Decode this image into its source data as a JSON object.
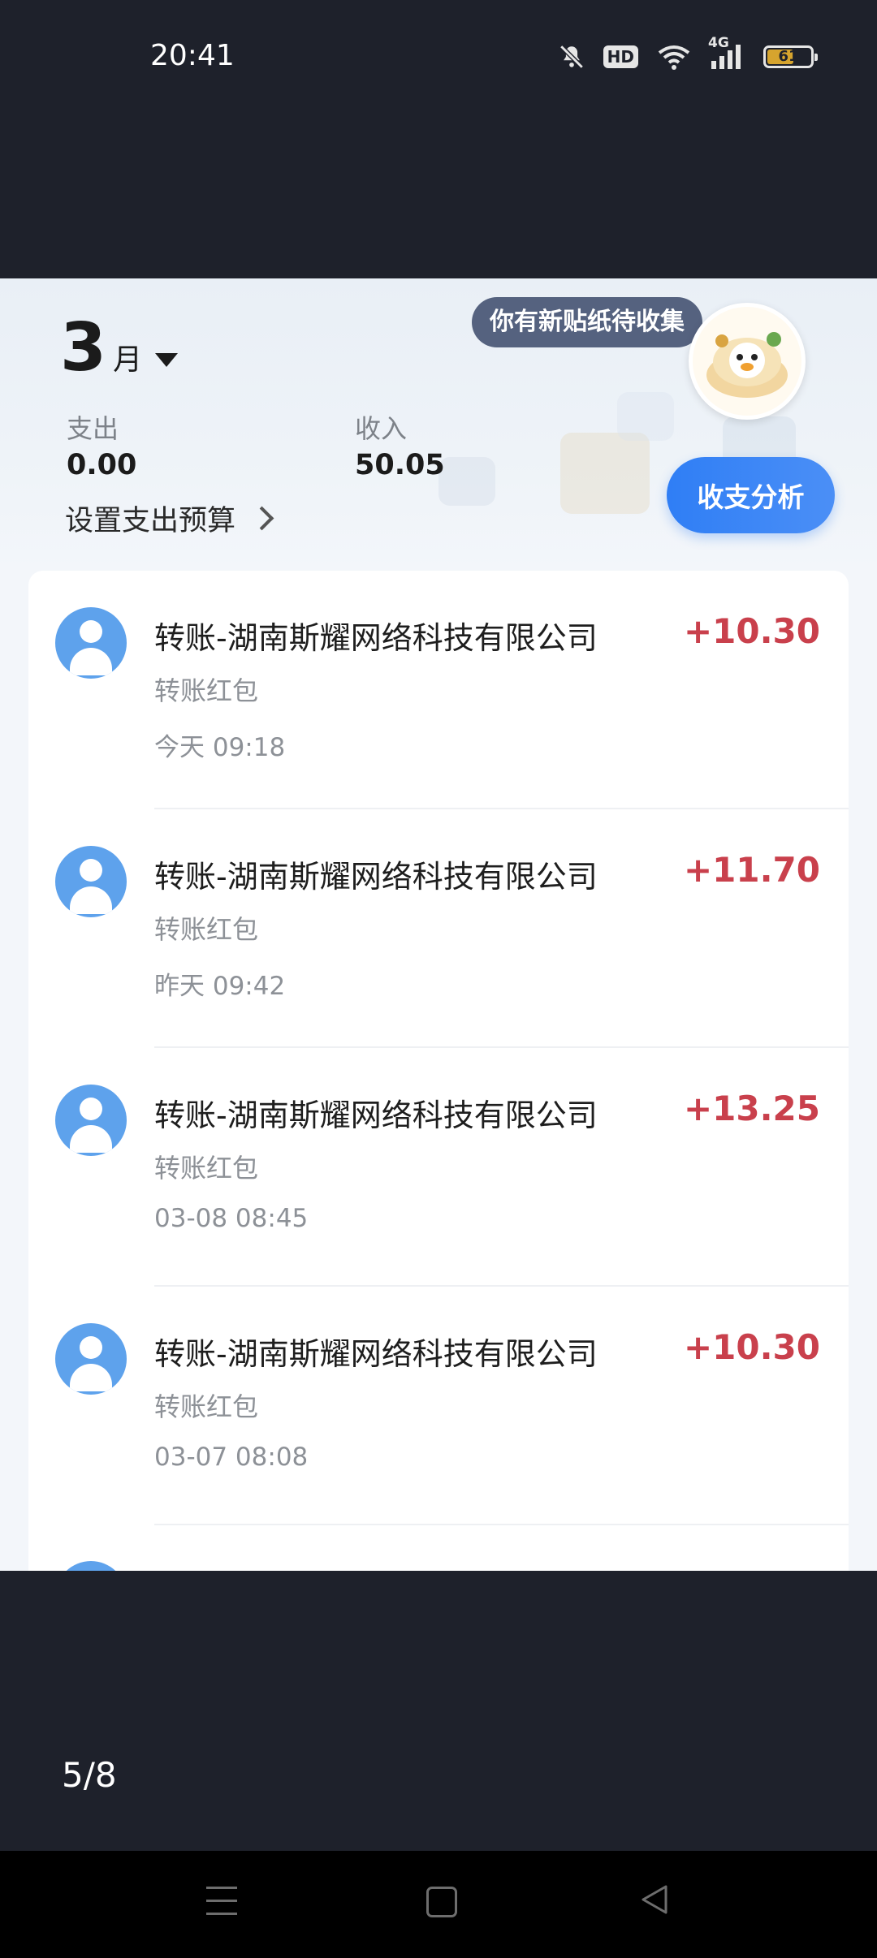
{
  "status_bar": {
    "time": "20:41",
    "hd_label": "HD",
    "network_label": "4G",
    "battery_level": "61",
    "battery_fill_fraction": 0.61
  },
  "header": {
    "month_number": "3",
    "month_unit": "月",
    "sticker_text": "你有新贴纸待收集",
    "expense_label": "支出",
    "expense_value": "0.00",
    "income_label": "收入",
    "income_value": "50.05",
    "budget_label": "设置支出预算",
    "analysis_button": "收支分析"
  },
  "transactions": [
    {
      "title": "转账-湖南斯耀网络科技有限公司",
      "subtitle": "转账红包",
      "time": "今天 09:18",
      "amount": "+10.30"
    },
    {
      "title": "转账-湖南斯耀网络科技有限公司",
      "subtitle": "转账红包",
      "time": "昨天 09:42",
      "amount": "+11.70"
    },
    {
      "title": "转账-湖南斯耀网络科技有限公司",
      "subtitle": "转账红包",
      "time": "03-08 08:45",
      "amount": "+13.25"
    },
    {
      "title": "转账-湖南斯耀网络科技有限公司",
      "subtitle": "转账红包",
      "time": "03-07 08:08",
      "amount": "+10.30"
    }
  ],
  "viewer": {
    "page_counter": "5/8"
  },
  "colors": {
    "background": "#1e212b",
    "income_amount": "#c9404c",
    "analysis_button": "#2f7ef5",
    "avatar": "#5ea2ec"
  },
  "icons": {
    "mute": "bell-off-icon",
    "wifi": "wifi-icon",
    "signal": "signal-bars-icon",
    "battery": "battery-icon",
    "dropdown": "caret-down-icon",
    "budget_arrow": "chevron-right-icon",
    "avatar": "user-avatar-icon",
    "nav_menu": "menu-icon",
    "nav_home": "home-square-icon",
    "nav_back": "back-triangle-icon"
  }
}
